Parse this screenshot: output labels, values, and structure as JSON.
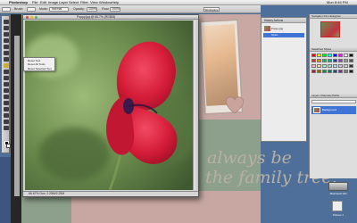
{
  "menubar": {
    "apple": "",
    "app_name": "Photoshop",
    "items": [
      "File",
      "Edit",
      "Image",
      "Layer",
      "Select",
      "Filter",
      "View",
      "Window",
      "Help"
    ],
    "clock": "Mon 8:46 PM"
  },
  "optbar": {
    "items": [
      "Brush:",
      "Mode:",
      "Normal",
      "Opacity:",
      "100%",
      "Flow:",
      "100%"
    ],
    "workspace_label": "Workspace"
  },
  "document": {
    "title": "Poppy.jpg @ 66.7% (RGB/8)",
    "status": "66.67%     Doc: 2.25M/2.25M"
  },
  "context_menu": {
    "items": [
      "Reset Tool",
      "Reset All Tools",
      "Reset Selected Tool"
    ]
  },
  "history_panel": {
    "tabs": "History  Actions",
    "source_row": "Poppy.jpg",
    "selected_row": "Open"
  },
  "navigator_panel": {
    "tabs": "Navigator  Info  Histogram"
  },
  "swatches_panel": {
    "tabs": "Swatches  Styles"
  },
  "layers_panel": {
    "tabs": "Layers  Channels  Paths",
    "layer_name": "Background"
  },
  "scrapbook": {
    "line1": "always be",
    "line2": "the family tree."
  },
  "desktop": {
    "icon1": "Macintosh HD",
    "icon2": "Picture 1"
  },
  "colors": {
    "menubar": "#e6e6e6",
    "scrapbook_green": "#8da08b",
    "scrapbook_pink": "#c9a8a3",
    "selection_blue": "#3f74d6",
    "poppy_red": "#d6203a"
  }
}
